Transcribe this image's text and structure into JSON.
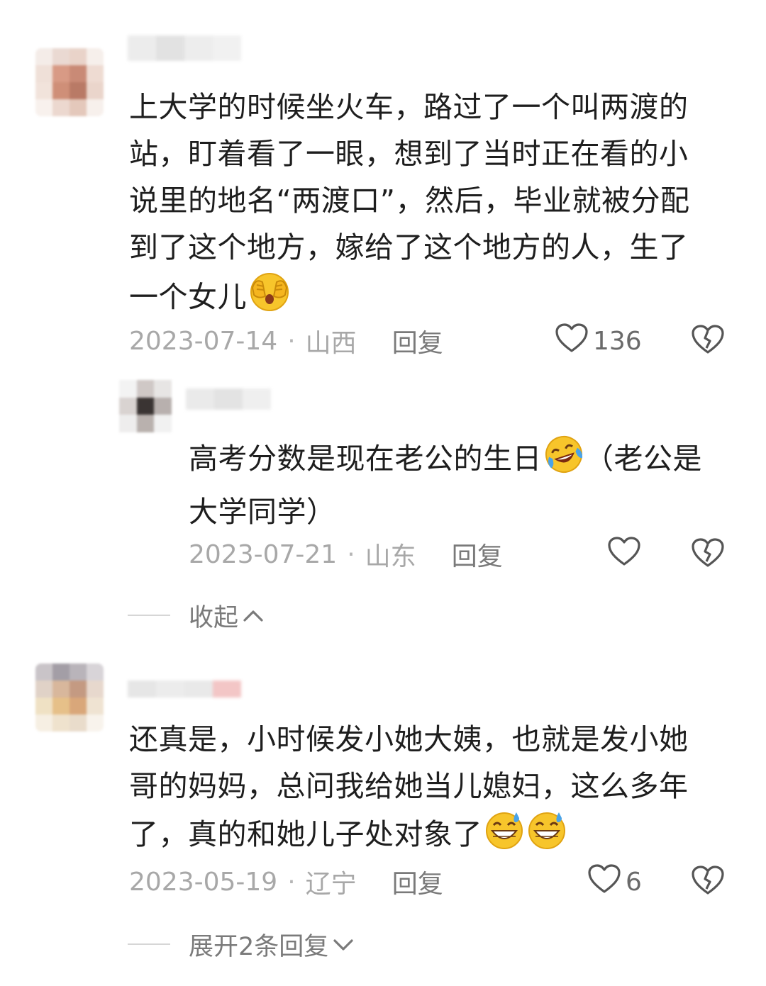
{
  "comments": [
    {
      "text": "上大学的时候坐火车，路过了一个叫两渡的站，盯着看了一眼，想到了当时正在看的小说里的地名“两渡口”，然后，毕业就被分配到了这个地方，嫁给了这个地方的人，生了一个女儿",
      "emojis": [
        "face-with-hands-over-mouth-emoji"
      ],
      "date": "2023-07-14",
      "location": "山西",
      "reply_label": "回复",
      "likes": "136",
      "replies": [
        {
          "text": "高考分数是现在老公的生日",
          "emoji": "crying-laughing-emoji",
          "text_after": "（老公是大学同学）",
          "date": "2023-07-21",
          "location": "山东",
          "reply_label": "回复",
          "likes": ""
        }
      ],
      "toggle_label": "收起"
    },
    {
      "text": "还真是，小时候发小她大姨，也就是发小她哥的妈妈，总问我给她当儿媳妇，这么多年了，真的和她儿子处对象了",
      "emojis": [
        "grinning-sweat-emoji",
        "grinning-sweat-emoji"
      ],
      "date": "2023-05-19",
      "location": "辽宁",
      "reply_label": "回复",
      "likes": "6",
      "toggle_label": "展开2条回复"
    }
  ],
  "separator_dot": "·",
  "colors": {
    "text": "#1e1e1e",
    "meta": "#a8a8a8",
    "action": "#6a6a6a",
    "emoji_yellow": "#f7c52b"
  }
}
